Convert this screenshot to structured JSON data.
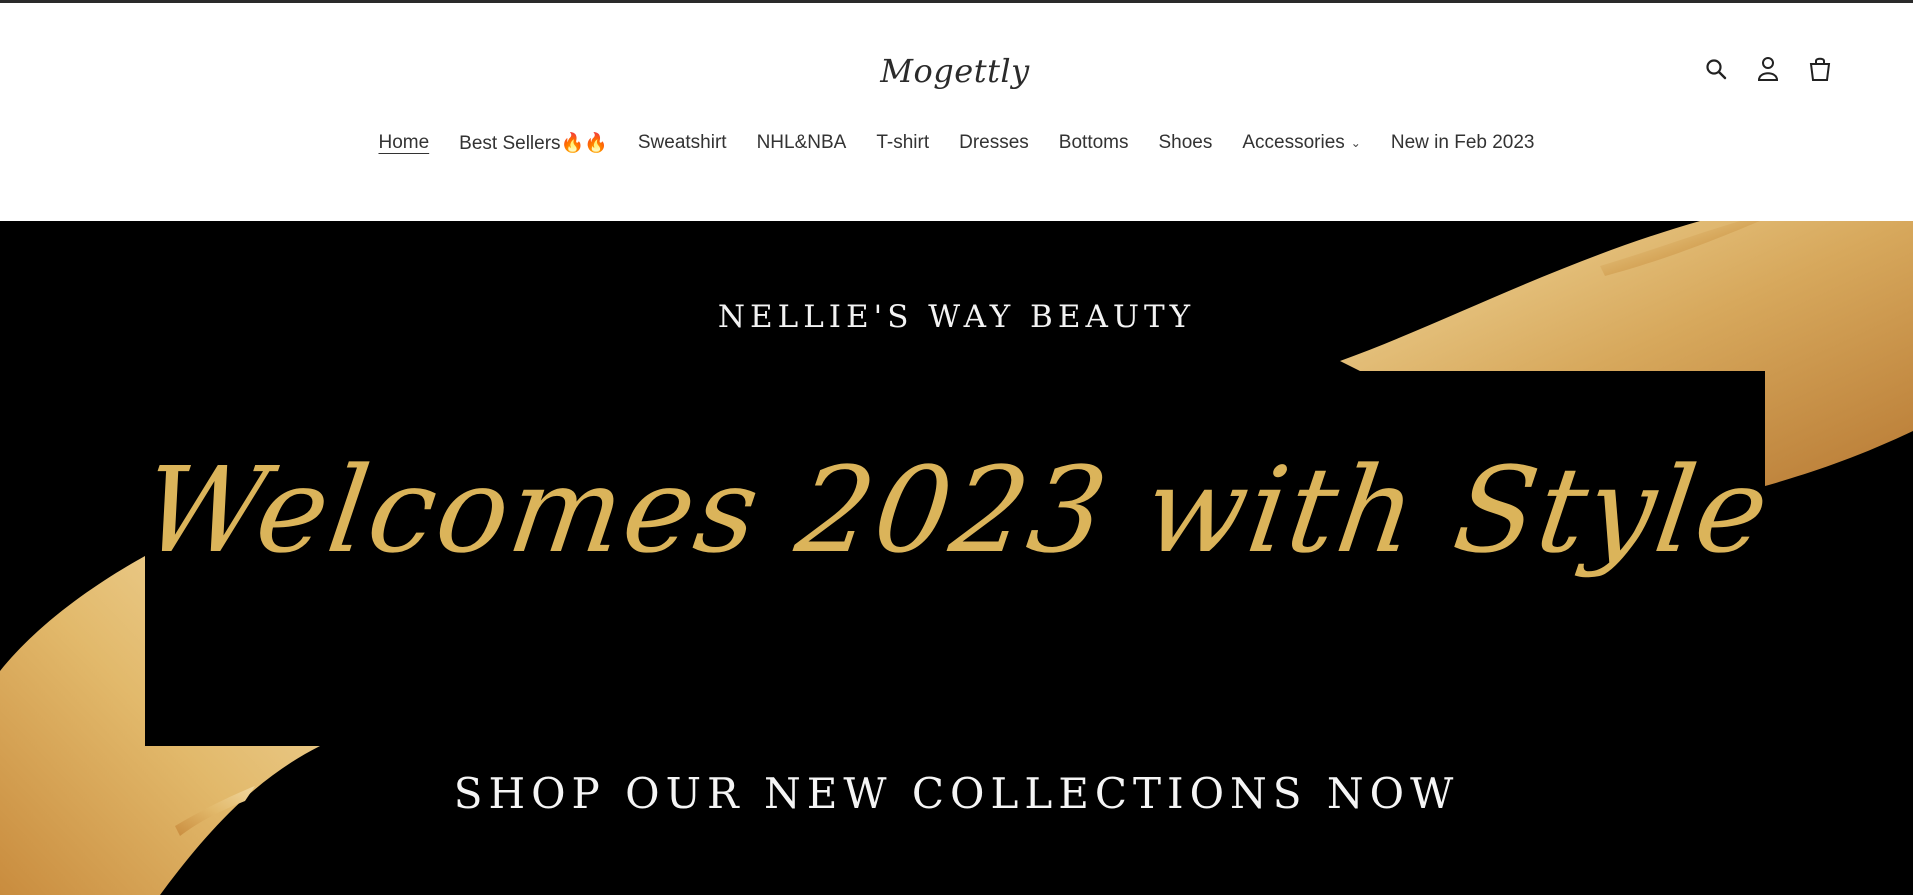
{
  "brand": {
    "logo_text": "Mogettly"
  },
  "header_icons": [
    "search-icon",
    "account-icon",
    "cart-icon"
  ],
  "nav": {
    "items": [
      {
        "label": "Home",
        "active": true
      },
      {
        "label": "Best Sellers🔥🔥"
      },
      {
        "label": "Sweatshirt"
      },
      {
        "label": "NHL&NBA"
      },
      {
        "label": "T-shirt"
      },
      {
        "label": "Dresses"
      },
      {
        "label": "Bottoms"
      },
      {
        "label": "Shoes"
      },
      {
        "label": "Accessories",
        "has_dropdown": true
      },
      {
        "label": "New in Feb 2023"
      }
    ]
  },
  "hero": {
    "subtitle": "NELLIE'S WAY BEAUTY",
    "title": "Welcomes 2023 with Style",
    "cta": "SHOP OUR NEW COLLECTIONS NOW"
  },
  "colors": {
    "gold": "#dbb45a",
    "hero_bg": "#000000",
    "text": "#333333"
  }
}
